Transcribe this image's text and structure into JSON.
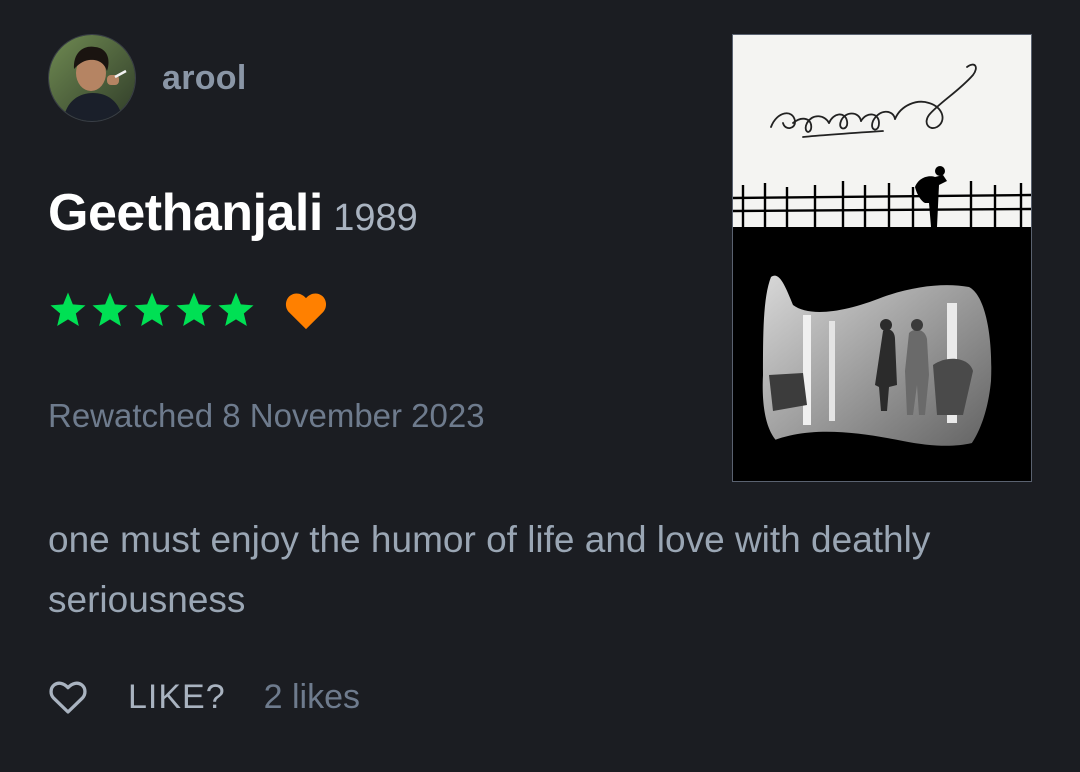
{
  "review": {
    "username": "arool",
    "film_title": "Geethanjali",
    "film_year": "1989",
    "rating_stars": 5,
    "liked": true,
    "watched_label": "Rewatched 8 November 2023",
    "review_body": "one must enjoy the humor of life and love with deathly seriousness",
    "like_button_label": "LIKE?",
    "likes_count": "2 likes"
  },
  "colors": {
    "background": "#1b1d22",
    "star": "#00e054",
    "liked_heart": "#ff8000",
    "muted_text": "#6e7b8d"
  },
  "icons": {
    "star": "star-icon",
    "liked": "heart-icon",
    "like_action": "heart-outline-icon"
  }
}
